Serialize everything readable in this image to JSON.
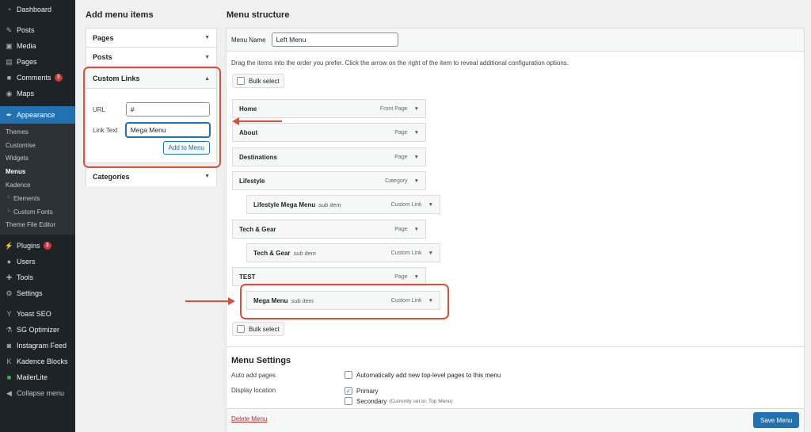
{
  "sidebar": {
    "items_top": [
      {
        "label": "Dashboard",
        "icon": "dashboard-icon"
      },
      {
        "label": "Posts",
        "icon": "pin-icon"
      },
      {
        "label": "Media",
        "icon": "media-icon"
      },
      {
        "label": "Pages",
        "icon": "pages-icon"
      },
      {
        "label": "Comments",
        "icon": "comment-icon",
        "badge": "3"
      },
      {
        "label": "Maps",
        "icon": "map-icon"
      }
    ],
    "appearance": "Appearance",
    "appearance_sub": [
      "Themes",
      "Customise",
      "Widgets",
      "Menus",
      "Kadence",
      "Elements",
      "Custom Fonts",
      "Theme File Editor"
    ],
    "items_bottom": [
      {
        "label": "Plugins",
        "icon": "plugin-icon",
        "badge": "3"
      },
      {
        "label": "Users",
        "icon": "users-icon"
      },
      {
        "label": "Tools",
        "icon": "tools-icon"
      },
      {
        "label": "Settings",
        "icon": "settings-icon"
      }
    ],
    "items_extra": [
      {
        "label": "Yoast SEO",
        "icon": "yoast-icon"
      },
      {
        "label": "SG Optimizer",
        "icon": "sg-optimizer-icon"
      },
      {
        "label": "Instagram Feed",
        "icon": "instagram-icon"
      },
      {
        "label": "Kadence Blocks",
        "icon": "kadence-icon"
      },
      {
        "label": "MailerLite",
        "icon": "mailerlite-icon"
      },
      {
        "label": "Collapse menu",
        "icon": "collapse-icon"
      }
    ]
  },
  "add_menu_items": {
    "heading": "Add menu items",
    "pages": "Pages",
    "posts": "Posts",
    "custom_links": "Custom Links",
    "url_label": "URL",
    "url_value": "#",
    "link_text_label": "Link Text",
    "link_text_value": "Mega Menu",
    "add_button": "Add to Menu",
    "categories": "Categories"
  },
  "menu_structure": {
    "heading": "Menu structure",
    "menu_name_label": "Menu Name",
    "menu_name_value": "Left Menu",
    "instructions": "Drag the items into the order you prefer. Click the arrow on the right of the item to reveal additional configuration options.",
    "bulk_select": "Bulk select",
    "items": [
      {
        "title": "Home",
        "sub": "",
        "type": "Front Page"
      },
      {
        "title": "About",
        "sub": "",
        "type": "Page"
      },
      {
        "title": "Destinations",
        "sub": "",
        "type": "Page"
      },
      {
        "title": "Lifestyle",
        "sub": "",
        "type": "Category"
      },
      {
        "title": "Lifestyle Mega Menu",
        "sub": "sub item",
        "type": "Custom Link"
      },
      {
        "title": "Tech & Gear",
        "sub": "",
        "type": "Page"
      },
      {
        "title": "Tech & Gear",
        "sub": "sub item",
        "type": "Custom Link"
      },
      {
        "title": "TEST",
        "sub": "",
        "type": "Page"
      },
      {
        "title": "Mega Menu",
        "sub": "sub item",
        "type": "Custom Link"
      }
    ]
  },
  "menu_settings": {
    "heading": "Menu Settings",
    "auto_add_label": "Auto add pages",
    "auto_add_option": "Automatically add new top-level pages to this menu",
    "display_location_label": "Display location",
    "primary": "Primary",
    "secondary": "Secondary",
    "secondary_note": "(Currently set to: Top Menu)"
  },
  "footer": {
    "delete": "Delete Menu",
    "save": "Save Menu"
  },
  "colors": {
    "accent": "#2271b1",
    "highlight": "#d9513c",
    "sidebar": "#1d2327"
  }
}
